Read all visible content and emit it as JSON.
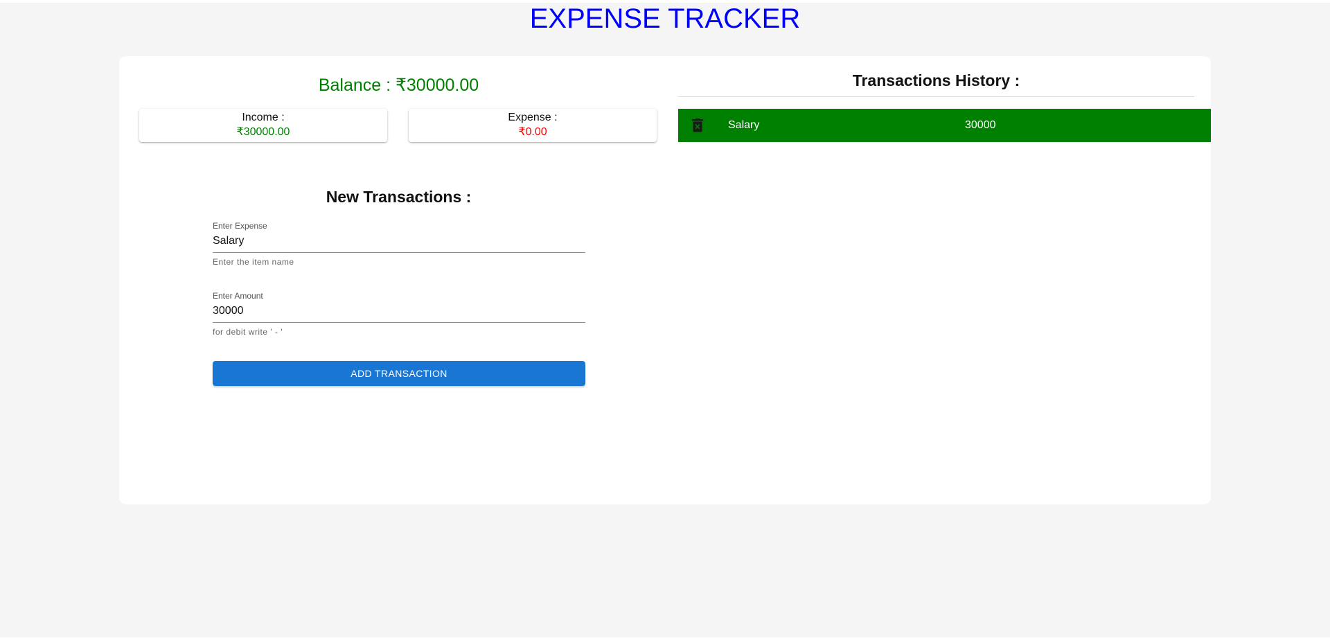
{
  "app": {
    "title": "EXPENSE TRACKER"
  },
  "summary": {
    "balance_text": "Balance : ₹30000.00",
    "income_label": "Income :",
    "income_value": "₹30000.00",
    "expense_label": "Expense :",
    "expense_value": "₹0.00"
  },
  "new_transaction": {
    "title": "New Transactions :",
    "expense_field": {
      "label": "Enter Expense",
      "value": "Salary",
      "helper": "Enter the item name"
    },
    "amount_field": {
      "label": "Enter Amount",
      "value": "30000",
      "helper": "for debit write ' - '"
    },
    "add_button_label": "ADD TRANSACTION"
  },
  "history": {
    "title": "Transactions History :",
    "items": [
      {
        "name": "Salary",
        "amount": "30000",
        "icon": "delete-icon"
      }
    ]
  },
  "colors": {
    "title": "#0000ff",
    "income": "#008000",
    "expense": "#ff0000",
    "history_row": "#008000",
    "button": "#1976d2",
    "page_background": "#f5f5f5"
  }
}
